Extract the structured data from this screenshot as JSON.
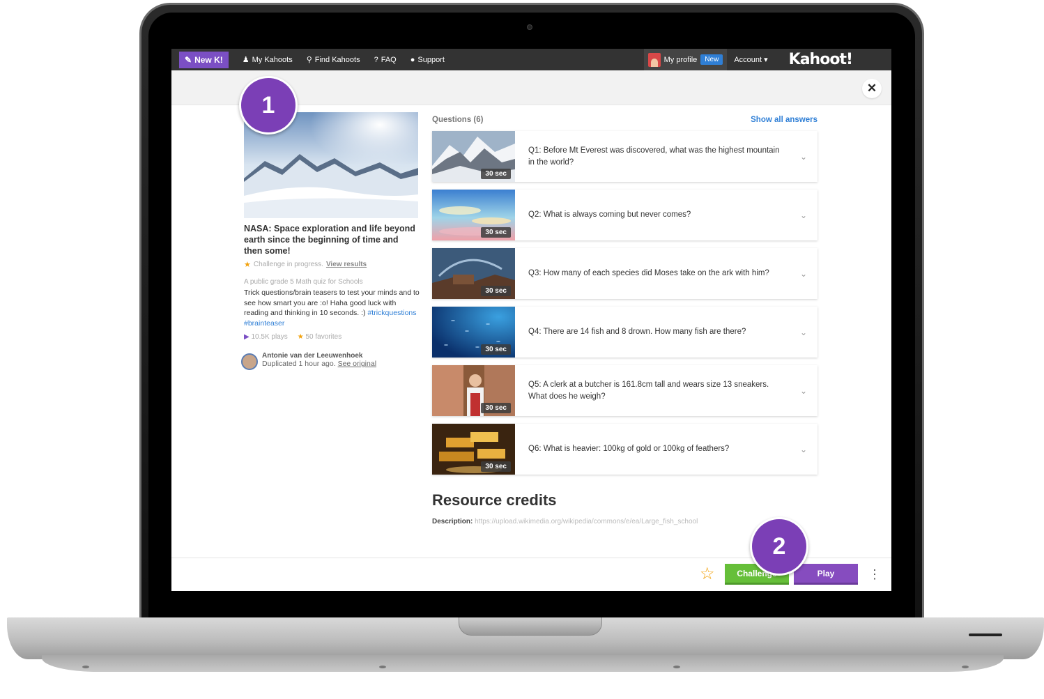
{
  "nav": {
    "new_k": "New K!",
    "my_kahoots": "My Kahoots",
    "find_kahoots": "Find Kahoots",
    "faq": "FAQ",
    "support": "Support",
    "my_profile": "My profile",
    "new_badge": "New",
    "account": "Account",
    "logo": "Kahoot!"
  },
  "kahoot": {
    "title": "NASA: Space exploration and life beyond earth since the beginning of time and then some!",
    "challenge_status": "Challenge in progress.",
    "view_results": "View results",
    "meta": "A public grade 5 Math quiz for Schools",
    "description": "Trick questions/brain teasers to test your minds and to see how smart you are :o! Haha good luck with reading and thinking in 10 seconds. :)",
    "tags": "#trickquestions #brainteaser",
    "plays": "10.5K plays",
    "favorites": "50 favorites",
    "author": "Antonie van der Leeuwenhoek",
    "duplicated": "Duplicated 1 hour ago.",
    "see_original": "See original"
  },
  "questions_header": {
    "count_label": "Questions (6)",
    "show_all": "Show all answers"
  },
  "questions": [
    {
      "text": "Q1: Before Mt Everest was discovered, what was the highest mountain in the world?",
      "time": "30 sec"
    },
    {
      "text": "Q2: What is always coming but never comes?",
      "time": "30 sec"
    },
    {
      "text": "Q3: How many of each species did Moses take on the ark with him?",
      "time": "30 sec"
    },
    {
      "text": "Q4: There are 14 fish and 8 drown. How many fish are there?",
      "time": "30 sec"
    },
    {
      "text": "Q5: A clerk at a butcher is 161.8cm tall and wears size 13 sneakers. What does he weigh?",
      "time": "30 sec"
    },
    {
      "text": "Q6: What is heavier: 100kg of gold or 100kg of feathers?",
      "time": "30 sec"
    }
  ],
  "credits": {
    "title": "Resource credits",
    "label": "Description:",
    "url": "https://upload.wikimedia.org/wikipedia/commons/e/ea/Large_fish_school"
  },
  "footer": {
    "challenge": "Challenge",
    "play": "Play"
  },
  "callouts": {
    "one": "1",
    "two": "2"
  },
  "colors": {
    "purple": "#864cbf",
    "green": "#66bf39",
    "link_blue": "#2f7fd6",
    "nav_bg": "#333333"
  }
}
